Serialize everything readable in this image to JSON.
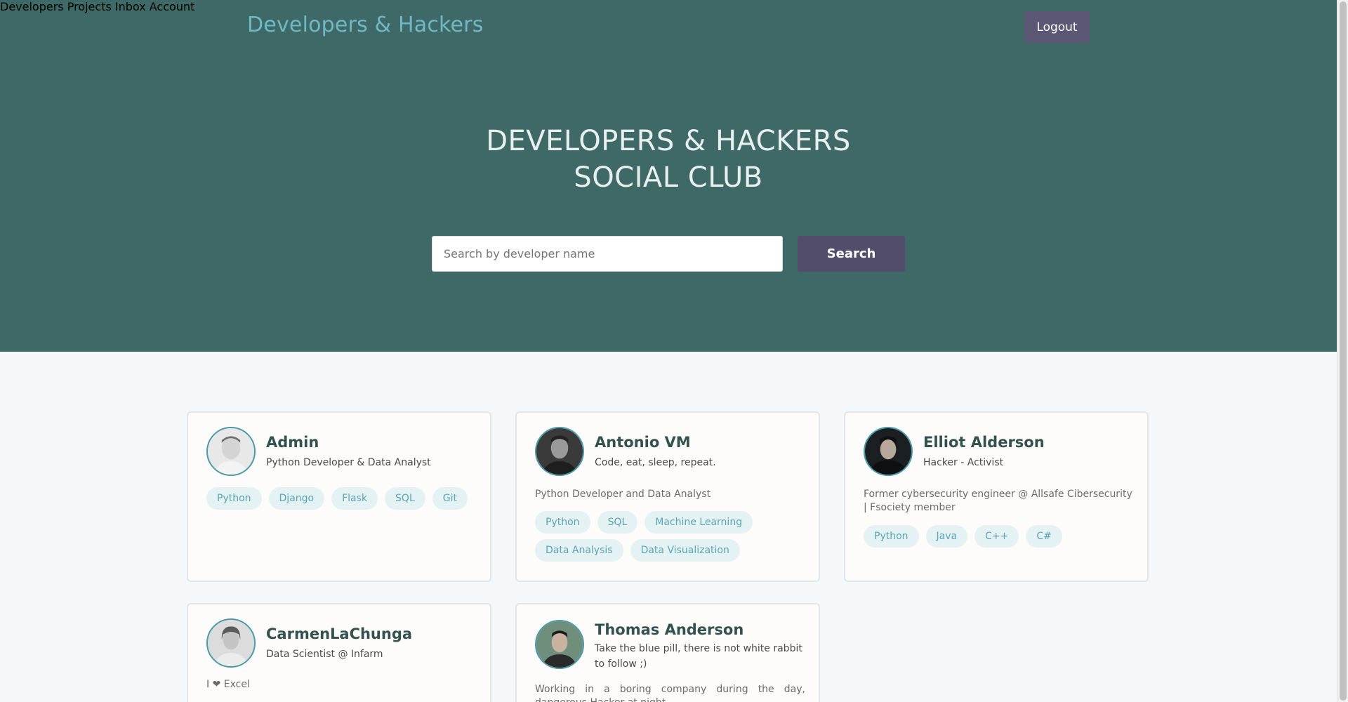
{
  "header": {
    "logo": "Developers & Hackers",
    "nav": [
      "Developers",
      "Projects",
      "Inbox",
      "Account"
    ],
    "logout": "Logout"
  },
  "hero": {
    "title_line1": "DEVELOPERS & HACKERS",
    "title_line2": "SOCIAL CLUB",
    "search_placeholder": "Search by developer name",
    "search_value": "",
    "search_button": "Search"
  },
  "colors": {
    "hero_bg": "#3f6966",
    "logo": "#6fb8c6",
    "button": "#514d6b",
    "tag_bg": "#e4f2f4",
    "tag_text": "#5ba4b3"
  },
  "developers": [
    {
      "name": "Admin",
      "headline": "Python Developer & Data Analyst",
      "bio": "",
      "tags": [
        "Python",
        "Django",
        "Flask",
        "SQL",
        "Git"
      ]
    },
    {
      "name": "Antonio VM",
      "headline": "Code, eat, sleep, repeat.",
      "bio": "Python Developer and Data Analyst",
      "tags": [
        "Python",
        "SQL",
        "Machine Learning",
        "Data Analysis",
        "Data Visualization"
      ]
    },
    {
      "name": "Elliot Alderson",
      "headline": "Hacker - Activist",
      "bio": "Former cybersecurity engineer @ Allsafe Cibersecurity | Fsociety member",
      "tags": [
        "Python",
        "Java",
        "C++",
        "C#"
      ]
    },
    {
      "name": "CarmenLaChunga",
      "headline": "Data Scientist @ Infarm",
      "bio": "I ❤ Excel",
      "tags": []
    },
    {
      "name": "Thomas Anderson",
      "headline": "Take the blue pill, there is not white rabbit to follow ;)",
      "bio": "Working in a boring company during the day, dangerous Hacker at night",
      "tags": []
    }
  ]
}
